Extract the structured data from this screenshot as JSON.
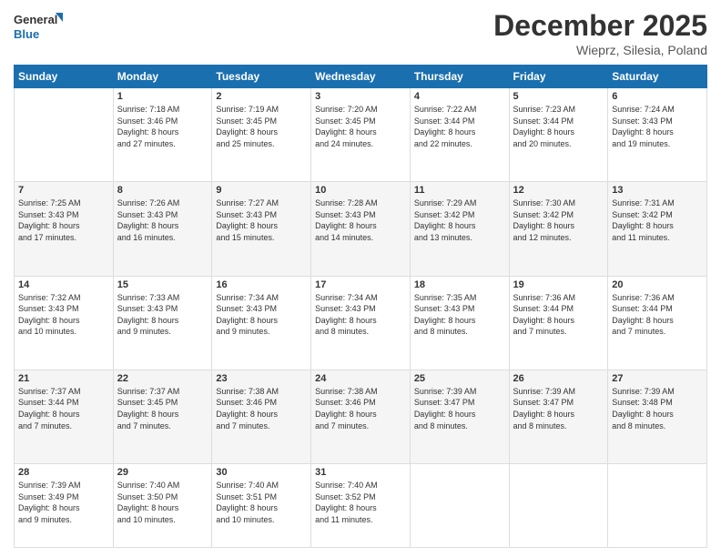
{
  "header": {
    "logo_line1": "General",
    "logo_line2": "Blue",
    "month": "December 2025",
    "location": "Wieprz, Silesia, Poland"
  },
  "weekdays": [
    "Sunday",
    "Monday",
    "Tuesday",
    "Wednesday",
    "Thursday",
    "Friday",
    "Saturday"
  ],
  "weeks": [
    [
      {
        "day": "",
        "info": ""
      },
      {
        "day": "1",
        "info": "Sunrise: 7:18 AM\nSunset: 3:46 PM\nDaylight: 8 hours\nand 27 minutes."
      },
      {
        "day": "2",
        "info": "Sunrise: 7:19 AM\nSunset: 3:45 PM\nDaylight: 8 hours\nand 25 minutes."
      },
      {
        "day": "3",
        "info": "Sunrise: 7:20 AM\nSunset: 3:45 PM\nDaylight: 8 hours\nand 24 minutes."
      },
      {
        "day": "4",
        "info": "Sunrise: 7:22 AM\nSunset: 3:44 PM\nDaylight: 8 hours\nand 22 minutes."
      },
      {
        "day": "5",
        "info": "Sunrise: 7:23 AM\nSunset: 3:44 PM\nDaylight: 8 hours\nand 20 minutes."
      },
      {
        "day": "6",
        "info": "Sunrise: 7:24 AM\nSunset: 3:43 PM\nDaylight: 8 hours\nand 19 minutes."
      }
    ],
    [
      {
        "day": "7",
        "info": "Sunrise: 7:25 AM\nSunset: 3:43 PM\nDaylight: 8 hours\nand 17 minutes."
      },
      {
        "day": "8",
        "info": "Sunrise: 7:26 AM\nSunset: 3:43 PM\nDaylight: 8 hours\nand 16 minutes."
      },
      {
        "day": "9",
        "info": "Sunrise: 7:27 AM\nSunset: 3:43 PM\nDaylight: 8 hours\nand 15 minutes."
      },
      {
        "day": "10",
        "info": "Sunrise: 7:28 AM\nSunset: 3:43 PM\nDaylight: 8 hours\nand 14 minutes."
      },
      {
        "day": "11",
        "info": "Sunrise: 7:29 AM\nSunset: 3:42 PM\nDaylight: 8 hours\nand 13 minutes."
      },
      {
        "day": "12",
        "info": "Sunrise: 7:30 AM\nSunset: 3:42 PM\nDaylight: 8 hours\nand 12 minutes."
      },
      {
        "day": "13",
        "info": "Sunrise: 7:31 AM\nSunset: 3:42 PM\nDaylight: 8 hours\nand 11 minutes."
      }
    ],
    [
      {
        "day": "14",
        "info": "Sunrise: 7:32 AM\nSunset: 3:43 PM\nDaylight: 8 hours\nand 10 minutes."
      },
      {
        "day": "15",
        "info": "Sunrise: 7:33 AM\nSunset: 3:43 PM\nDaylight: 8 hours\nand 9 minutes."
      },
      {
        "day": "16",
        "info": "Sunrise: 7:34 AM\nSunset: 3:43 PM\nDaylight: 8 hours\nand 9 minutes."
      },
      {
        "day": "17",
        "info": "Sunrise: 7:34 AM\nSunset: 3:43 PM\nDaylight: 8 hours\nand 8 minutes."
      },
      {
        "day": "18",
        "info": "Sunrise: 7:35 AM\nSunset: 3:43 PM\nDaylight: 8 hours\nand 8 minutes."
      },
      {
        "day": "19",
        "info": "Sunrise: 7:36 AM\nSunset: 3:44 PM\nDaylight: 8 hours\nand 7 minutes."
      },
      {
        "day": "20",
        "info": "Sunrise: 7:36 AM\nSunset: 3:44 PM\nDaylight: 8 hours\nand 7 minutes."
      }
    ],
    [
      {
        "day": "21",
        "info": "Sunrise: 7:37 AM\nSunset: 3:44 PM\nDaylight: 8 hours\nand 7 minutes."
      },
      {
        "day": "22",
        "info": "Sunrise: 7:37 AM\nSunset: 3:45 PM\nDaylight: 8 hours\nand 7 minutes."
      },
      {
        "day": "23",
        "info": "Sunrise: 7:38 AM\nSunset: 3:46 PM\nDaylight: 8 hours\nand 7 minutes."
      },
      {
        "day": "24",
        "info": "Sunrise: 7:38 AM\nSunset: 3:46 PM\nDaylight: 8 hours\nand 7 minutes."
      },
      {
        "day": "25",
        "info": "Sunrise: 7:39 AM\nSunset: 3:47 PM\nDaylight: 8 hours\nand 8 minutes."
      },
      {
        "day": "26",
        "info": "Sunrise: 7:39 AM\nSunset: 3:47 PM\nDaylight: 8 hours\nand 8 minutes."
      },
      {
        "day": "27",
        "info": "Sunrise: 7:39 AM\nSunset: 3:48 PM\nDaylight: 8 hours\nand 8 minutes."
      }
    ],
    [
      {
        "day": "28",
        "info": "Sunrise: 7:39 AM\nSunset: 3:49 PM\nDaylight: 8 hours\nand 9 minutes."
      },
      {
        "day": "29",
        "info": "Sunrise: 7:40 AM\nSunset: 3:50 PM\nDaylight: 8 hours\nand 10 minutes."
      },
      {
        "day": "30",
        "info": "Sunrise: 7:40 AM\nSunset: 3:51 PM\nDaylight: 8 hours\nand 10 minutes."
      },
      {
        "day": "31",
        "info": "Sunrise: 7:40 AM\nSunset: 3:52 PM\nDaylight: 8 hours\nand 11 minutes."
      },
      {
        "day": "",
        "info": ""
      },
      {
        "day": "",
        "info": ""
      },
      {
        "day": "",
        "info": ""
      }
    ]
  ]
}
